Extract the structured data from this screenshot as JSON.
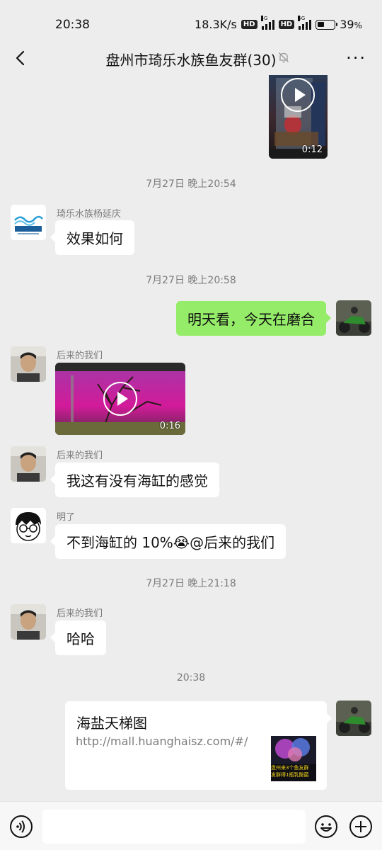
{
  "status_bar": {
    "time": "20:38",
    "network_speed": "18.3K/s",
    "hd_badge_1": "HD",
    "signal_1_label": "4G",
    "hd_badge_2": "HD",
    "signal_2_label": "5G",
    "battery": "39",
    "battery_unit": "%",
    "battery_level": 0.39
  },
  "header": {
    "title": "盘州市琦乐水族鱼友群(30)",
    "icons": [
      "back-icon",
      "mute-icon",
      "more-icon"
    ],
    "more_glyph": "···"
  },
  "messages": {
    "video_top": {
      "duration": "0:12"
    },
    "time_1": "7月27日 晚上20:54",
    "msg_1": {
      "sender": "琦乐水族杨延庆",
      "text": "效果如何",
      "avatar_logo": "琦乐水族"
    },
    "time_2": "7月27日 晚上20:58",
    "msg_2": {
      "text": "明天看，今天在磨合"
    },
    "msg_3": {
      "sender": "后来的我们",
      "duration": "0:16"
    },
    "msg_4": {
      "sender": "后来的我们",
      "text": "我这有没有海缸的感觉"
    },
    "msg_5": {
      "sender": "明了",
      "text": "不到海缸的 10%😭@后来的我们"
    },
    "time_3": "7月27日 晚上21:18",
    "msg_6": {
      "sender": "后来的我们",
      "text": "哈哈"
    },
    "time_4": "20:38",
    "link_card": {
      "title": "海盐天梯图",
      "url": "http://mall.huanghaisz.com/#/",
      "thumb_caption_1": "盘州来3个鱼友群",
      "thumb_caption_2": "发群得1瓶乳酸菌"
    }
  },
  "input_bar": {
    "placeholder": "",
    "icons": [
      "voice-icon",
      "emoji-icon",
      "plus-icon"
    ]
  },
  "colors": {
    "background": "#ededed",
    "bubble_self": "#95ec69",
    "bubble_other": "#ffffff",
    "muted_text": "#7b7b7b"
  }
}
